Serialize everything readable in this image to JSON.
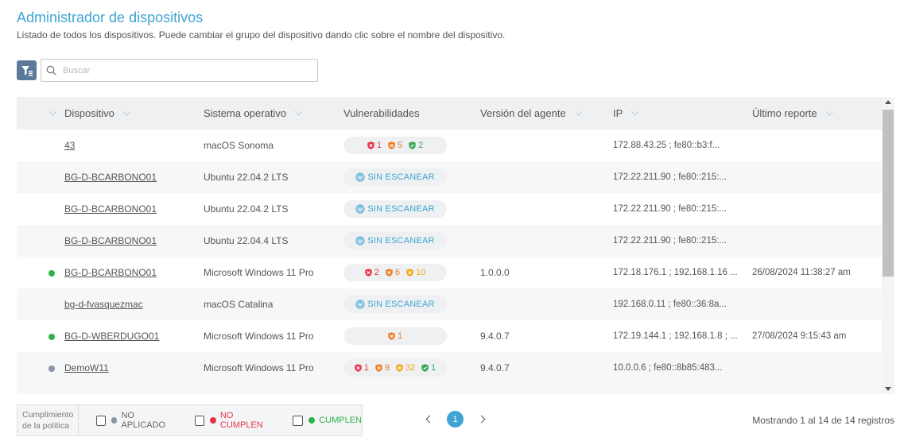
{
  "header": {
    "title": "Administrador de dispositivos",
    "subtitle": "Listado de todos los dispositivos. Puede cambiar el grupo del dispositivo dando clic sobre el nombre del dispositivo."
  },
  "search": {
    "placeholder": "Buscar"
  },
  "colors": {
    "accent": "#3fa4d4",
    "status_green": "#2fb14a",
    "status_gray": "#8a94a6",
    "vuln_red": "#e8334a",
    "vuln_orange": "#f07d22",
    "vuln_yellow": "#f2a818",
    "vuln_green": "#35a852"
  },
  "table": {
    "columns": [
      "Dispositivo",
      "Sistema operativo",
      "Vulnerabilidades",
      "Versión del agente",
      "IP",
      "Último reporte"
    ],
    "rows": [
      {
        "status": "",
        "device": "43",
        "os": "macOS Sonoma",
        "agent": "",
        "ip": "172.88.43.25 ; fe80::b3:f...",
        "report": "",
        "vuln": {
          "scanned": true,
          "red": "1",
          "orange": "5",
          "yellow": "",
          "green": "2"
        }
      },
      {
        "status": "",
        "device": "BG-D-BCARBONO01",
        "os": "Ubuntu 22.04.2 LTS",
        "agent": "",
        "ip": "172.22.211.90 ; fe80::215:...",
        "report": "",
        "vuln": {
          "scanned": false,
          "label": "SIN ESCANEAR"
        }
      },
      {
        "status": "",
        "device": "BG-D-BCARBONO01",
        "os": "Ubuntu 22.04.2 LTS",
        "agent": "",
        "ip": "172.22.211.90 ; fe80::215:...",
        "report": "",
        "vuln": {
          "scanned": false,
          "label": "SIN ESCANEAR"
        }
      },
      {
        "status": "",
        "device": "BG-D-BCARBONO01",
        "os": "Ubuntu 22.04.4 LTS",
        "agent": "",
        "ip": "172.22.211.90 ; fe80::215:...",
        "report": "",
        "vuln": {
          "scanned": false,
          "label": "SIN ESCANEAR"
        }
      },
      {
        "status": "green",
        "device": "BG-D-BCARBONO01",
        "os": "Microsoft Windows 11 Pro",
        "agent": "1.0.0.0",
        "ip": "172.18.176.1 ; 192.168.1.16 ...",
        "report": "26/08/2024 11:38:27 am",
        "vuln": {
          "scanned": true,
          "red": "2",
          "orange": "6",
          "yellow": "10",
          "green": ""
        }
      },
      {
        "status": "",
        "device": "bg-d-fvasquezmac",
        "os": "macOS Catalina",
        "agent": "",
        "ip": "192.168.0.11 ; fe80::36:8a...",
        "report": "",
        "vuln": {
          "scanned": false,
          "label": "SIN ESCANEAR"
        }
      },
      {
        "status": "green",
        "device": "BG-D-WBERDUGO01",
        "os": "Microsoft Windows 11 Pro",
        "agent": "9.4.0.7",
        "ip": "172.19.144.1 ; 192.168.1.8 ; ...",
        "report": "27/08/2024 9:15:43 am",
        "vuln": {
          "scanned": true,
          "red": "",
          "orange": "1",
          "yellow": "",
          "green": ""
        }
      },
      {
        "status": "gray",
        "device": "DemoW11",
        "os": "Microsoft Windows 11 Pro",
        "agent": "9.4.0.7",
        "ip": "10.0.0.6 ; fe80::8b85:483...",
        "report": "",
        "vuln": {
          "scanned": true,
          "red": "1",
          "orange": "9",
          "yellow": "32",
          "green": "1"
        }
      }
    ]
  },
  "legend": {
    "title": "Cumplimiento de la política",
    "items": [
      {
        "label": "NO APLICADO",
        "color": "#8a94a6"
      },
      {
        "label": "NO CUMPLEN",
        "color": "#e8334a"
      },
      {
        "label": "CUMPLEN",
        "color": "#2fb14a"
      }
    ]
  },
  "pagination": {
    "current_page": "1",
    "summary": "Mostrando 1 al 14 de 14 registros"
  }
}
